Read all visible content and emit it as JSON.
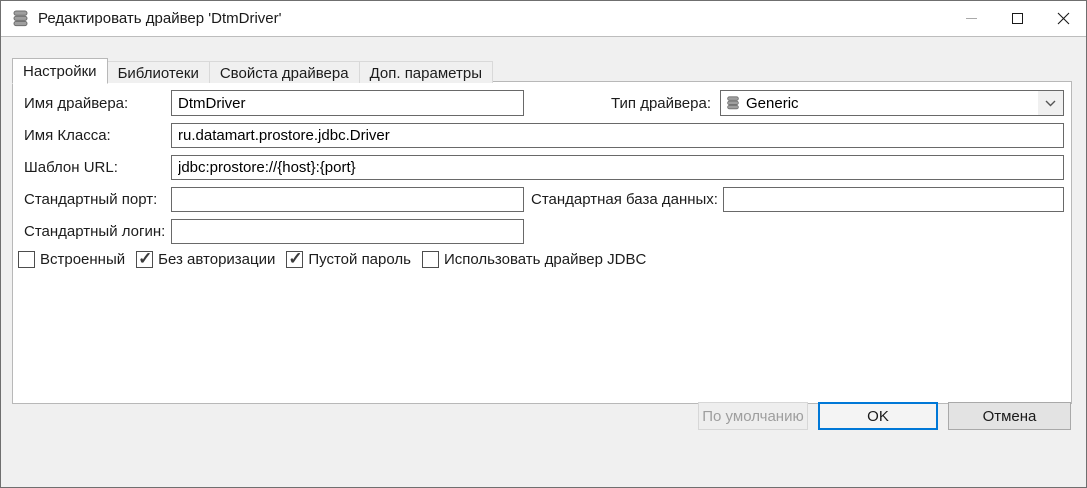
{
  "window": {
    "title": "Редактировать драйвер 'DtmDriver'",
    "icon": "database-icon",
    "controls": {
      "minimize": "minimize-icon",
      "maximize": "maximize-icon",
      "close": "close-icon"
    }
  },
  "tabs": [
    {
      "label": "Настройки",
      "active": true
    },
    {
      "label": "Библиотеки",
      "active": false
    },
    {
      "label": "Свойста драйвера",
      "active": false
    },
    {
      "label": "Доп. параметры",
      "active": false
    }
  ],
  "form": {
    "driver_name": {
      "label": "Имя драйвера:",
      "value": "DtmDriver"
    },
    "driver_type": {
      "label": "Тип драйвера:",
      "value": "Generic",
      "icon": "database-icon",
      "dropdown_icon": "chevron-down-icon"
    },
    "class_name": {
      "label": "Имя Класса:",
      "value": "ru.datamart.prostore.jdbc.Driver"
    },
    "url_template": {
      "label": "Шаблон URL:",
      "value": "jdbc:prostore://{host}:{port}"
    },
    "default_port": {
      "label": "Стандартный порт:",
      "value": ""
    },
    "default_database": {
      "label": "Стандартная база данных:",
      "value": ""
    },
    "default_login": {
      "label": "Стандартный логин:",
      "value": ""
    },
    "checkboxes": [
      {
        "label": "Встроенный",
        "checked": false
      },
      {
        "label": "Без авторизации",
        "checked": true
      },
      {
        "label": "Пустой пароль",
        "checked": true
      },
      {
        "label": "Использовать драйвер JDBC",
        "checked": false
      }
    ]
  },
  "buttons": {
    "default_label": "По умолчанию",
    "ok_label": "OK",
    "cancel_label": "Отмена"
  },
  "colors": {
    "accent": "#0078d7",
    "dialog_bg": "#f0f0f0",
    "panel_bg": "#ffffff"
  }
}
